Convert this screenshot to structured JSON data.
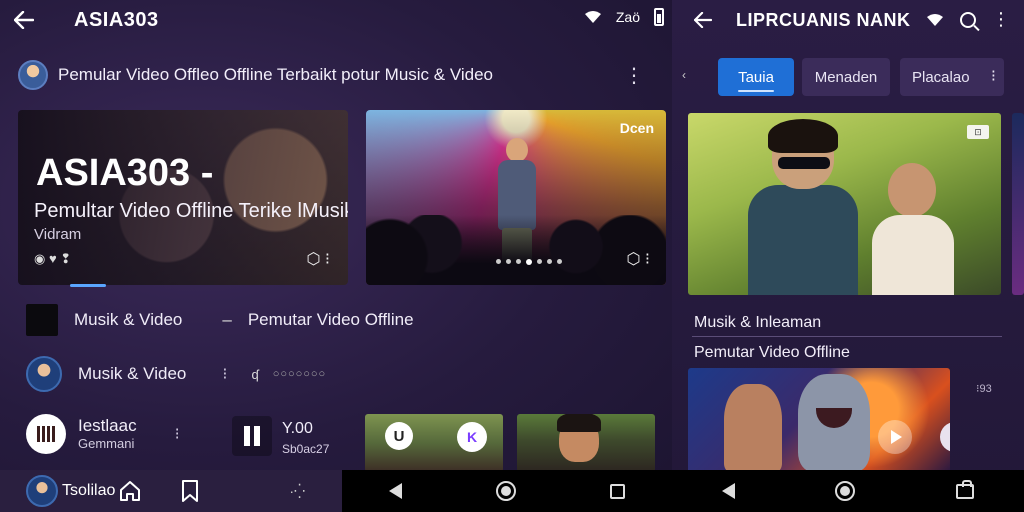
{
  "left": {
    "status": {
      "app_title": "ASIA303",
      "right_text": "Zaö"
    },
    "channel": {
      "title": "Pemular Video Offleo Offline Terbaikt potur Music & Video"
    },
    "hero": {
      "title": "ASIA303 -",
      "subtitle": "Pemultar Video Offline Terike lMusik",
      "caption": "Vidram",
      "controls": "◉ ♥ ❢",
      "more": "⬡ ⁝"
    },
    "concert": {
      "badge": "Dcen",
      "more": "⬡ ⁝"
    },
    "rows": {
      "row1_label": "Musik & Video",
      "row1_sep": "–",
      "row1_label2": "Pemutar Video Offline",
      "row2_label": "Musik & Video",
      "row2_dots": "⁝",
      "row2_mini": "ʠ",
      "row2_tiny": "○○○○○○○",
      "user_name": "Iestlaac",
      "user_sub": "Gemmani",
      "user_dots": "⁝",
      "track_time": "Y.00",
      "track_sub": "Sb0ac27"
    },
    "mini_cards": {
      "logo1": "U",
      "logo2": "K"
    },
    "bottom": {
      "name": "Tsolilao",
      "extra": "·⁛"
    }
  },
  "right": {
    "title": "LIPRCUANIS NANK",
    "tabs_mark": "‹",
    "tabs": [
      {
        "label": "Tauia",
        "active": true
      },
      {
        "label": "Menaden",
        "active": false
      },
      {
        "label": "Placalao",
        "active": false
      }
    ],
    "tabs_kebab": "⁝",
    "hero_badge": "⊡",
    "label1": "Musik & Inleaman",
    "label2": "Pemutar Video Offline",
    "logo": "ꟽ",
    "side_meta": "⁝93"
  },
  "icons": {
    "back": "back-arrow-icon",
    "wifi": "wifi-icon",
    "battery": "battery-icon",
    "search": "search-icon",
    "kebab": "kebab-menu-icon",
    "home": "home-icon",
    "bookmark": "bookmark-icon"
  },
  "colors": {
    "background": "#261b3e",
    "accent": "#1f6fd6",
    "tab_inactive": "#3b2c5a",
    "progress": "#5aa6ff"
  }
}
